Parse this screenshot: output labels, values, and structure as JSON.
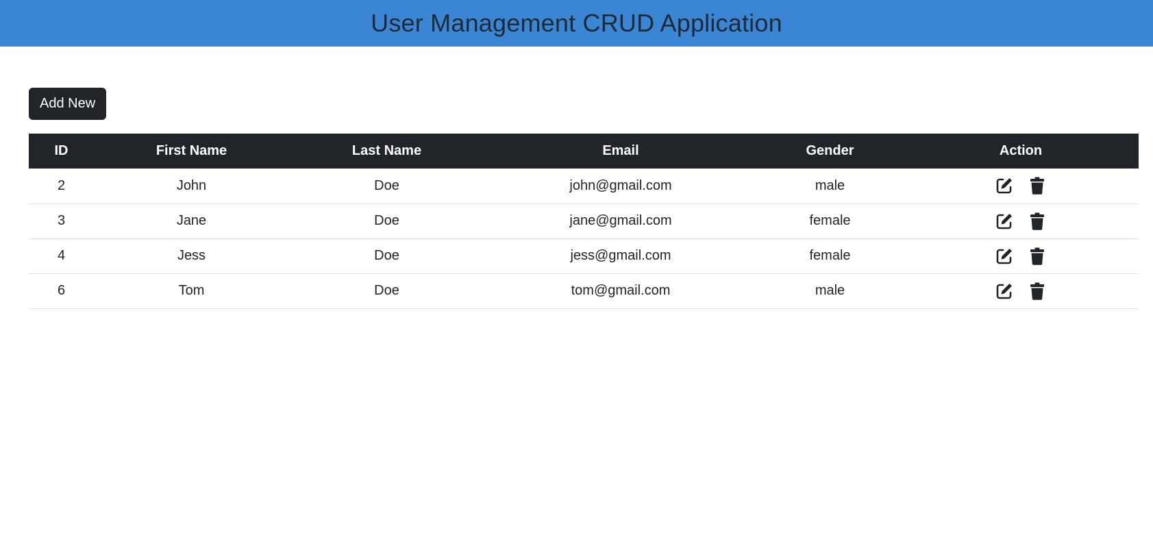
{
  "header": {
    "title": "User Management CRUD Application",
    "background": "#3a86d4"
  },
  "toolbar": {
    "add_label": "Add New"
  },
  "table": {
    "columns": [
      "ID",
      "First Name",
      "Last Name",
      "Email",
      "Gender",
      "Action"
    ],
    "rows": [
      {
        "id": "2",
        "first_name": "John",
        "last_name": "Doe",
        "email": "john@gmail.com",
        "gender": "male"
      },
      {
        "id": "3",
        "first_name": "Jane",
        "last_name": "Doe",
        "email": "jane@gmail.com",
        "gender": "female"
      },
      {
        "id": "4",
        "first_name": "Jess",
        "last_name": "Doe",
        "email": "jess@gmail.com",
        "gender": "female"
      },
      {
        "id": "6",
        "first_name": "Tom",
        "last_name": "Doe",
        "email": "tom@gmail.com",
        "gender": "male"
      }
    ]
  },
  "icons": {
    "edit": "edit-icon",
    "delete": "trash-icon"
  },
  "colors": {
    "dark": "#212529",
    "accent": "#3a86d4",
    "border": "#dee2e6"
  }
}
